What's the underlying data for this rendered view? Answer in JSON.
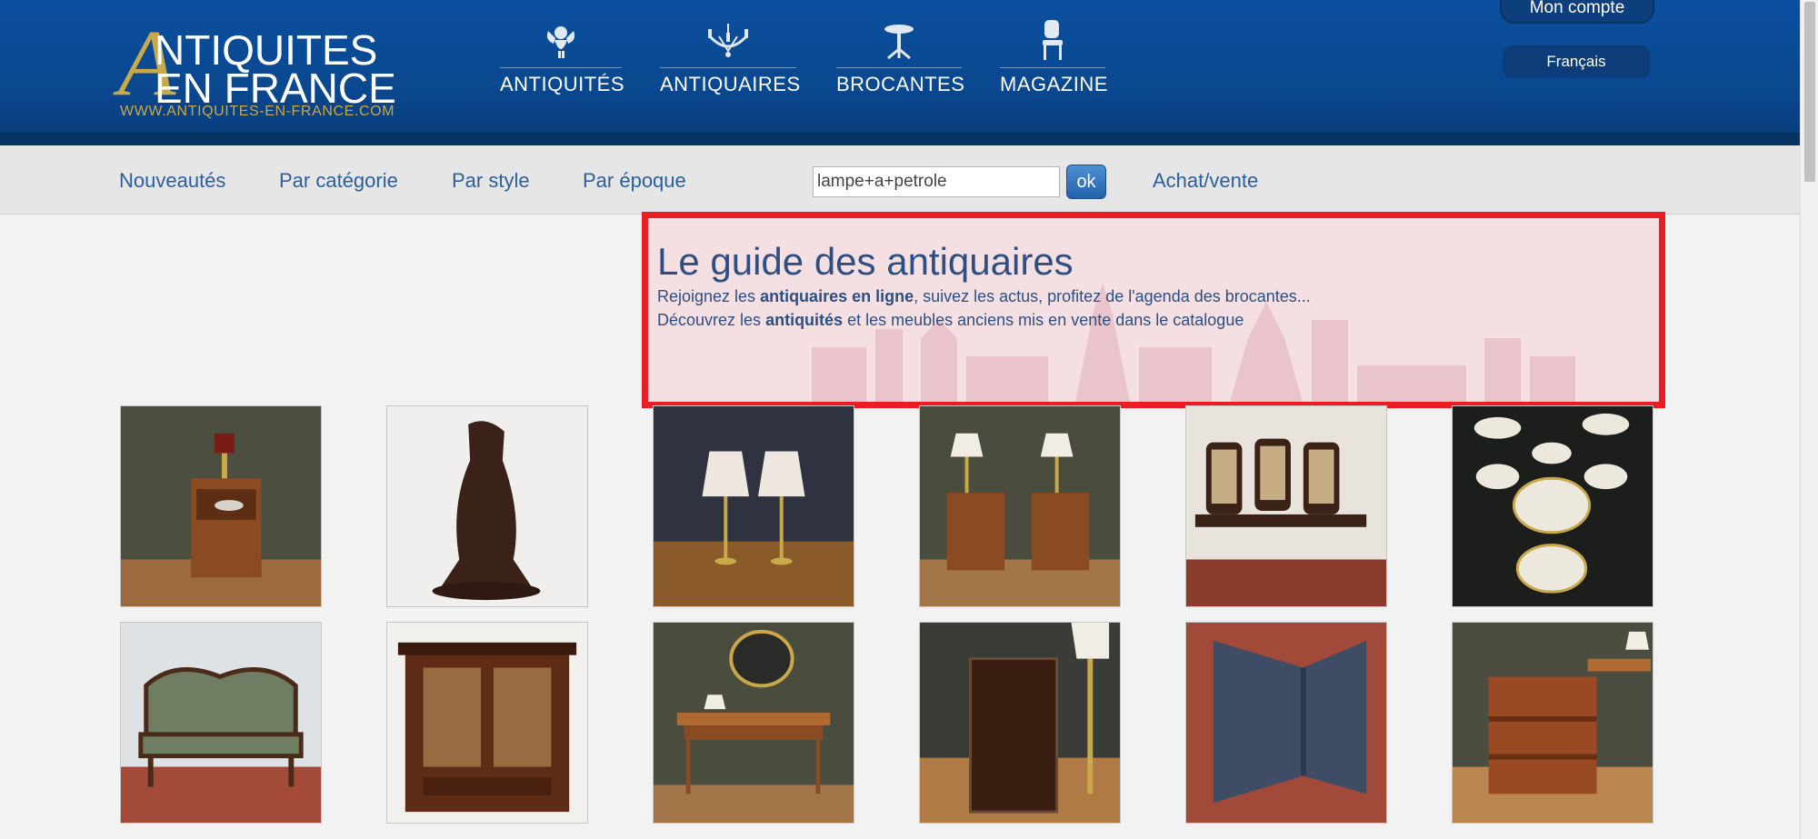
{
  "header": {
    "logo": {
      "big_letter": "A",
      "line1": "NTIQUITES",
      "line2": "EN FRANCE",
      "url": "WWW.ANTIQUITES-EN-FRANCE.COM"
    },
    "nav": [
      {
        "label": "ANTIQUITÉS",
        "icon": "cherub-icon"
      },
      {
        "label": "ANTIQUAIRES",
        "icon": "chandelier-icon"
      },
      {
        "label": "BROCANTES",
        "icon": "pedestal-table-icon"
      },
      {
        "label": "MAGAZINE",
        "icon": "chair-icon"
      }
    ],
    "account_label": "Mon compte",
    "language_label": "Français"
  },
  "subnav": {
    "items": [
      "Nouveautés",
      "Par catégorie",
      "Par style",
      "Par époque"
    ],
    "search_value": "lampe+a+petrole",
    "search_button": "ok",
    "achat_vente": "Achat/vente"
  },
  "guide": {
    "title": "Le guide des antiquaires",
    "line1_pre": "Rejoignez les ",
    "line1_bold": "antiquaires en ligne",
    "line1_post": ", suivez les actus, profitez de l'agenda des brocantes...",
    "line2_pre": "Découvrez les ",
    "line2_bold": "antiquités",
    "line2_post": " et les meubles anciens mis en vente dans le catalogue"
  },
  "colors": {
    "header_blue": "#0b4f9e",
    "gold": "#c9a84a",
    "link_blue": "#2c5f9e",
    "highlight_red": "#ec1c24"
  }
}
